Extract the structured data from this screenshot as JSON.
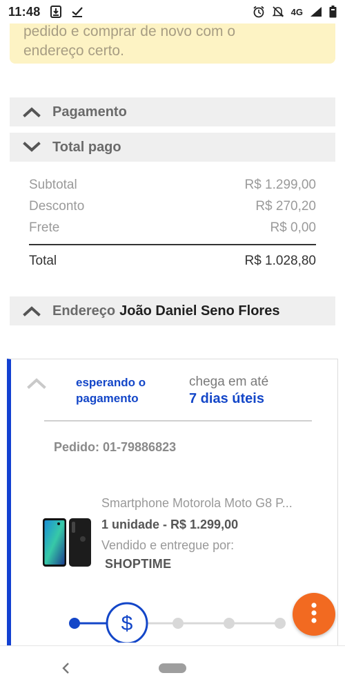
{
  "status_bar": {
    "time": "11:48",
    "network": "4G"
  },
  "notice": {
    "line1": "pedido e comprar de novo com o",
    "line2": "endereço certo."
  },
  "sections": {
    "payment_label": "Pagamento",
    "total_paid_label": "Total pago",
    "address_label": "Endereço",
    "address_name": "João Daniel Seno Flores"
  },
  "totals": {
    "subtotal_label": "Subtotal",
    "subtotal_value": "R$ 1.299,00",
    "discount_label": "Desconto",
    "discount_value": "R$ 270,20",
    "shipping_label": "Frete",
    "shipping_value": "R$ 0,00",
    "total_label": "Total",
    "total_value": "R$ 1.028,80"
  },
  "order": {
    "status": "esperando o pagamento",
    "eta_label": "chega em até",
    "eta_value": "7 dias úteis",
    "order_number": "Pedido: 01-79886823",
    "product_name": "Smartphone Motorola Moto G8 P...",
    "quantity_price": "1 unidade - R$ 1.299,00",
    "seller_label": "Vendido e entregue por:",
    "seller": "SHOPTIME",
    "progress_current_step": 2,
    "progress_total_steps": 5
  },
  "colors": {
    "accent_blue": "#1346c8",
    "card_border_blue": "#1240d1",
    "notice_bg": "#fdf3c4",
    "fab_orange": "#f26a21",
    "section_bg": "#efefef"
  },
  "icons": {
    "download": "download-icon",
    "check": "check-icon",
    "alarm": "alarm-icon",
    "muted_bell": "bell-off-icon",
    "signal": "signal-icon",
    "battery": "battery-icon",
    "chevron_up": "chevron-up-icon",
    "chevron_down": "chevron-down-icon",
    "dollar": "dollar-icon",
    "more": "more-vertical-icon",
    "back": "back-icon"
  }
}
